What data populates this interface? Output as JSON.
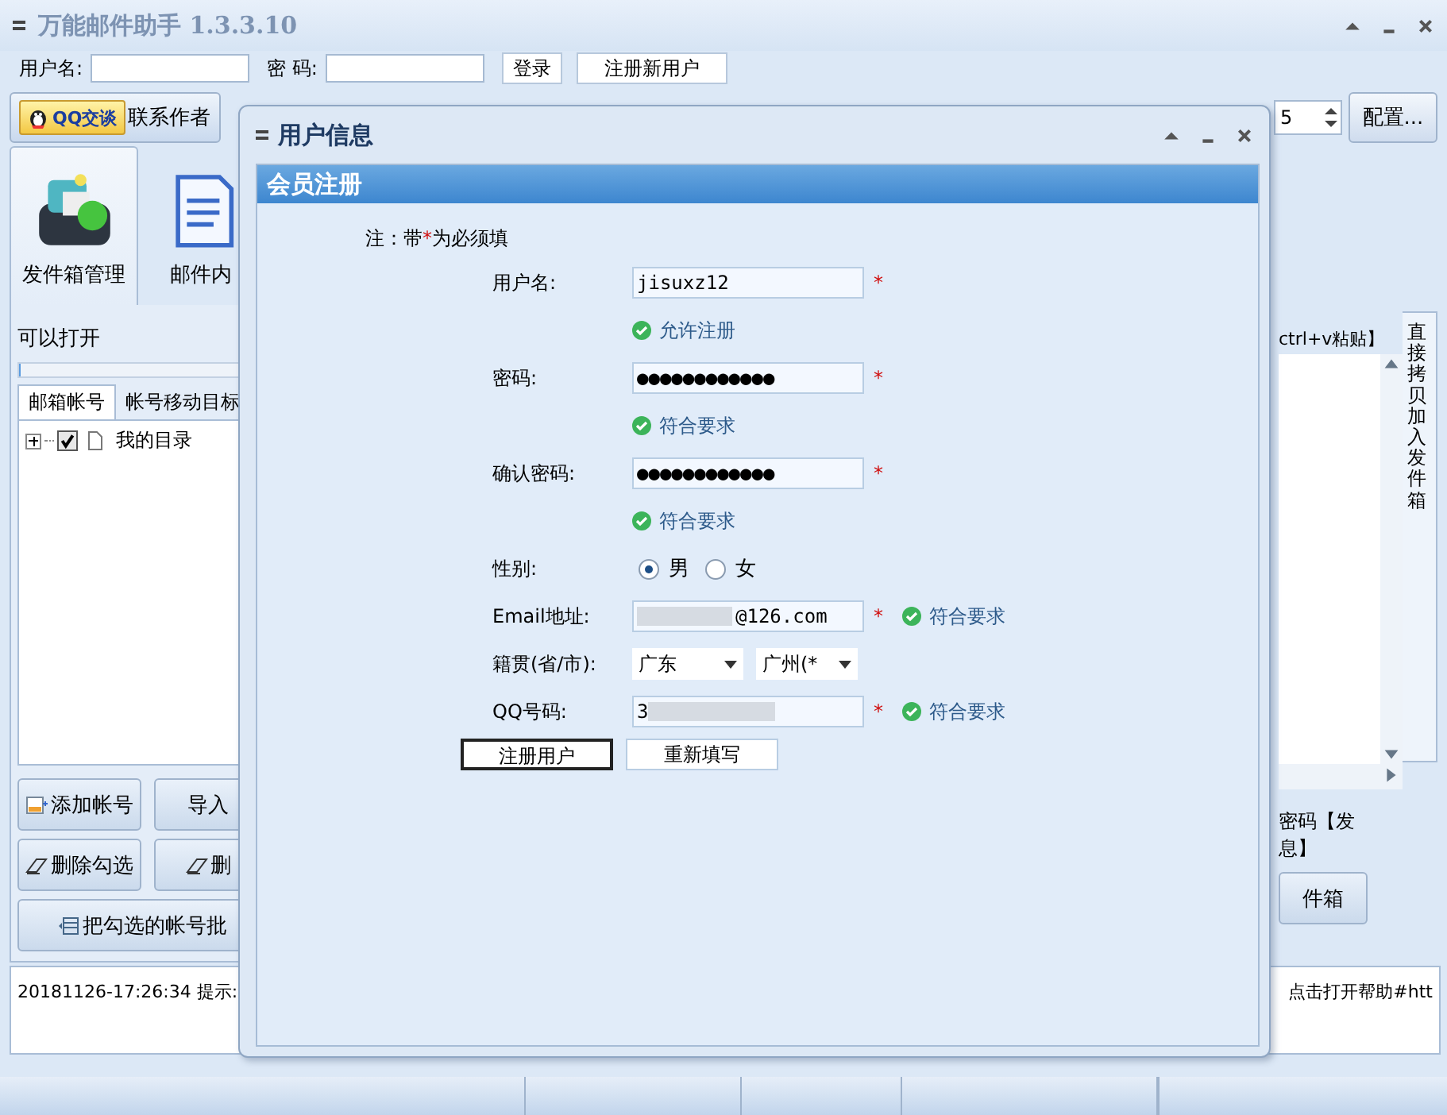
{
  "window": {
    "title": "万能邮件助手 1.3.3.10"
  },
  "login": {
    "username_label": "用户名:",
    "password_label": "密 码:",
    "login_button": "登录",
    "register_button": "注册新用户"
  },
  "toolbar": {
    "qq_button": "QQ交谈",
    "contact_label": "联系作者",
    "spinner_value": "5",
    "config_button": "配置..."
  },
  "left_panel": {
    "tabs": [
      {
        "label": "发件箱管理",
        "selected": true
      },
      {
        "label": "邮件内",
        "selected": false
      }
    ],
    "status_text": "可以打开",
    "progress": {
      "level": 0
    },
    "subtabs": [
      {
        "label": "邮箱帐号",
        "selected": true
      },
      {
        "label": "帐号移动目标",
        "selected": false
      }
    ],
    "tree": [
      {
        "label": "我的目录",
        "checked": true,
        "expanded": false
      }
    ],
    "button_rows": [
      [
        {
          "label": "添加帐号",
          "kind": "add"
        },
        {
          "label": "导入",
          "kind": "plain"
        }
      ],
      [
        {
          "label": "删除勾选",
          "kind": "erase"
        },
        {
          "label": "删",
          "kind": "erase"
        }
      ],
      [
        {
          "label": "把勾选的帐号批",
          "kind": "move"
        }
      ]
    ]
  },
  "right_panel": {
    "hint": "ctrl+v粘贴】",
    "side_tab": "直接拷贝加入发件箱",
    "note_lines": [
      "密码【发",
      "息】"
    ],
    "button": "件箱"
  },
  "log": {
    "left": "20181126-17:26:34 提示:",
    "right": "点击打开帮助#htt"
  },
  "dialog": {
    "title": "用户信息",
    "section": "会员注册",
    "note_prefix": "注：带",
    "note_mark": "*",
    "note_suffix": "为必须填",
    "fields": [
      {
        "kind": "text",
        "label": "用户名:",
        "value": "jisuxz12",
        "required": true,
        "status": "允许注册"
      },
      {
        "kind": "text",
        "label": "密码:",
        "value": "●●●●●●●●●●●●",
        "required": true,
        "status": "符合要求"
      },
      {
        "kind": "text",
        "label": "确认密码:",
        "value": "●●●●●●●●●●●●",
        "required": true,
        "status": "符合要求"
      },
      {
        "kind": "radio",
        "label": "性别:",
        "options": [
          {
            "label": "男",
            "selected": true
          },
          {
            "label": "女",
            "selected": false
          }
        ]
      },
      {
        "kind": "masked_start",
        "label": "Email地址:",
        "value": "@126.com",
        "required": true,
        "status": "符合要求"
      },
      {
        "kind": "select",
        "label": "籍贯(省/市):",
        "options": [
          {
            "label": "广东"
          },
          {
            "label": "广州(*"
          }
        ]
      },
      {
        "kind": "masked_end",
        "label": "QQ号码:",
        "value": "3",
        "required": true,
        "status": "符合要求"
      }
    ],
    "buttons": [
      {
        "label": "注册用户",
        "default": true
      },
      {
        "label": "重新填写",
        "default": false
      }
    ]
  }
}
